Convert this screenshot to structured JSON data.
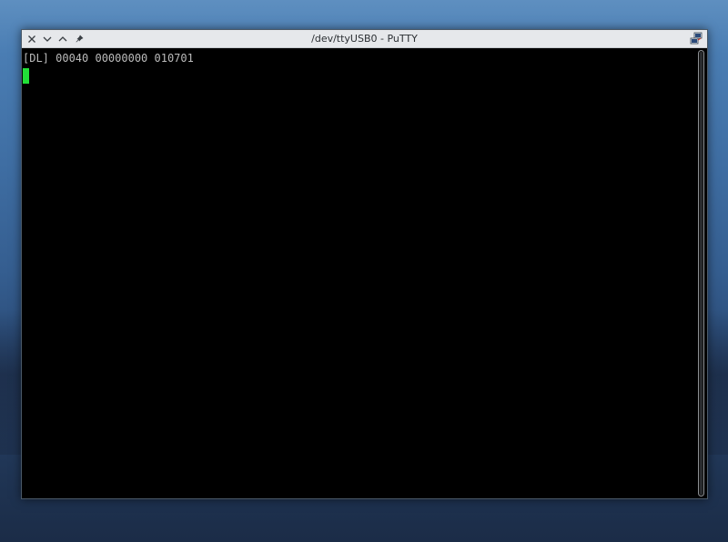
{
  "window": {
    "title": "/dev/ttyUSB0 - PuTTY"
  },
  "titlebar": {
    "buttons": [
      "close-icon",
      "minimize-icon",
      "maximize-icon",
      "pin-icon"
    ],
    "app_icon": "putty-icon"
  },
  "terminal": {
    "lines": [
      "[DL] 00040 00000000 010701"
    ],
    "cursor_color": "#22e038",
    "text_color": "#bbbbbb",
    "background": "#000000"
  }
}
